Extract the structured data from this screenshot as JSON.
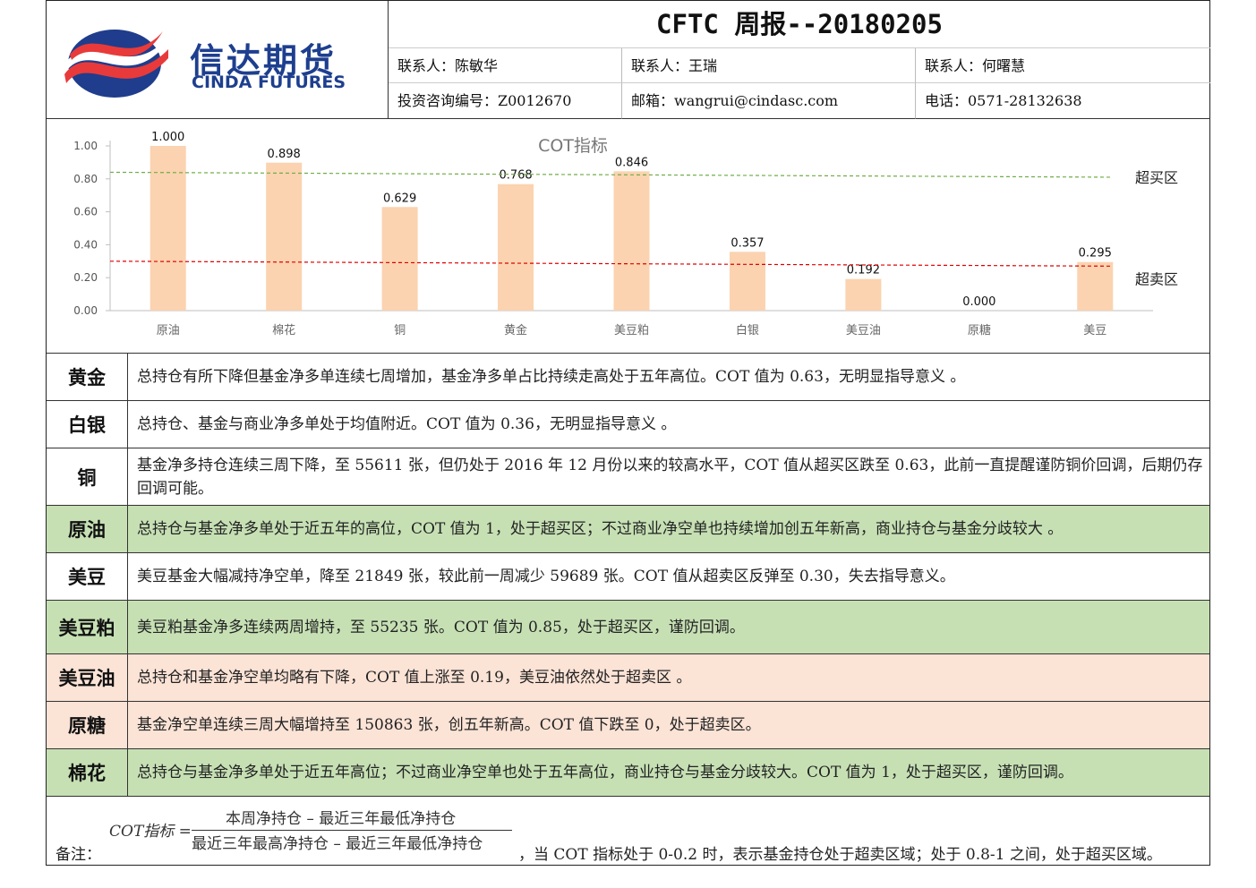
{
  "header": {
    "logo_cn": "信达期货",
    "logo_en": "CINDA FUTURES",
    "title": "CFTC 周报--20180205",
    "contact1": "联系人：陈敏华",
    "contact2": "联系人：王瑞",
    "contact3": "联系人：何曙慧",
    "license": "投资咨询编号：Z0012670",
    "email": "邮箱：wangrui@cindasc.com",
    "phone": "电话：0571-28132638"
  },
  "colors": {
    "bar": "#fbd3b0",
    "overbought_line": "#70ad47",
    "oversold_line": "#e00000",
    "green_row": "#c6e0b4",
    "salmon_row": "#fbe3d6"
  },
  "chart_data": {
    "type": "bar",
    "title": "COT指标",
    "categories": [
      "原油",
      "棉花",
      "铜",
      "黄金",
      "美豆粕",
      "白银",
      "美豆油",
      "原糖",
      "美豆"
    ],
    "values": [
      1.0,
      0.898,
      0.629,
      0.768,
      0.846,
      0.357,
      0.192,
      0.0,
      0.295
    ],
    "value_labels": [
      "1.000",
      "0.898",
      "0.629",
      "0.768",
      "0.846",
      "0.357",
      "0.192",
      "0.000",
      "0.295"
    ],
    "ylim": [
      0,
      1.0
    ],
    "yticks": [
      "0.00",
      "0.20",
      "0.40",
      "0.60",
      "0.80",
      "1.00"
    ],
    "overbought_line": {
      "label": "超买区",
      "y_start": 0.84,
      "y_end": 0.81
    },
    "oversold_line": {
      "label": "超卖区",
      "y_start": 0.3,
      "y_end": 0.27
    },
    "grid": false
  },
  "rows": [
    {
      "name": "黄金",
      "text": "总持仓有所下降但基金净多单连续七周增加，基金净多单占比持续走高处于五年高位。COT 值为 0.63，无明显指导意义 。",
      "style": "plain"
    },
    {
      "name": "白银",
      "text": "总持仓、基金与商业净多单处于均值附近。COT 值为 0.36，无明显指导意义 。",
      "style": "plain"
    },
    {
      "name": "铜",
      "text": "基金净多持仓连续三周下降，至 55611 张，但仍处于 2016 年 12 月份以来的较高水平，COT 值从超买区跌至 0.63，此前一直提醒谨防铜价回调，后期仍存回调可能。",
      "style": "plain"
    },
    {
      "name": "原油",
      "text": "总持仓与基金净多单处于近五年的高位，COT 值为 1，处于超买区；不过商业净空单也持续增加创五年新高，商业持仓与基金分歧较大 。",
      "style": "green"
    },
    {
      "name": "美豆",
      "text": "美豆基金大幅减持净空单，降至 21849 张，较此前一周减少 59689 张。COT 值从超卖区反弹至 0.30，失去指导意义。",
      "style": "plain"
    },
    {
      "name": "美豆粕",
      "text": "美豆粕基金净多连续两周增持，至 55235 张。COT 值为 0.85，处于超买区，谨防回调。",
      "style": "green"
    },
    {
      "name": "美豆油",
      "text": "总持仓和基金净空单均略有下降，COT 值上涨至 0.19，美豆油依然处于超卖区 。",
      "style": "salmon"
    },
    {
      "name": "原糖",
      "text": "基金净空单连续三周大幅增持至 150863 张，创五年新高。COT 值下跌至 0，处于超卖区。",
      "style": "salmon"
    },
    {
      "name": "棉花",
      "text": "总持仓与基金净多单处于近五年高位；不过商业净空单也处于五年高位，商业持仓与基金分歧较大。COT 值为 1，处于超买区，谨防回调。",
      "style": "green"
    }
  ],
  "footer": {
    "note_label": "备注：",
    "formula_lhs": "COT指标 =",
    "formula_numerator": "本周净持仓 – 最近三年最低净持仓",
    "formula_denominator": "最近三年最高净持仓 – 最近三年最低净持仓",
    "text": "，当 COT 指标处于 0-0.2 时，表示基金持仓处于超卖区域；处于 0.8-1 之间，处于超买区域。"
  }
}
